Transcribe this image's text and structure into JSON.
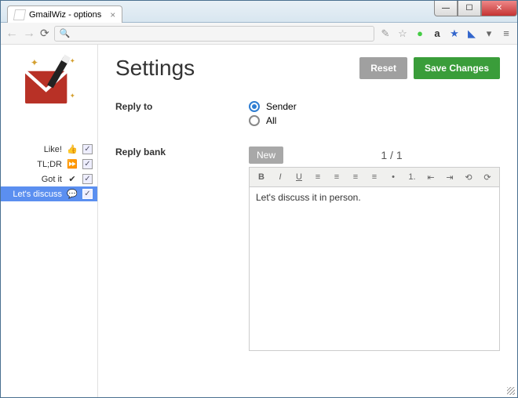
{
  "window": {
    "tab_title": "GmailWiz - options"
  },
  "addressbar": {
    "prefix_icon": "🔍"
  },
  "toolbar_icons": [
    "✎",
    "☆",
    "●",
    "a",
    "★",
    "◣",
    "▾",
    "≡"
  ],
  "sidebar": {
    "items": [
      {
        "label": "Like!",
        "icon": "👍",
        "checked": true,
        "selected": false
      },
      {
        "label": "TL;DR",
        "icon": "⏩",
        "checked": true,
        "selected": false
      },
      {
        "label": "Got it",
        "icon": "✔",
        "checked": true,
        "selected": false
      },
      {
        "label": "Let's discuss",
        "icon": "💬",
        "checked": true,
        "selected": true
      }
    ]
  },
  "page": {
    "title": "Settings",
    "reset_label": "Reset",
    "save_label": "Save Changes"
  },
  "reply_to": {
    "section_label": "Reply to",
    "options": [
      {
        "label": "Sender",
        "checked": true
      },
      {
        "label": "All",
        "checked": false
      }
    ]
  },
  "reply_bank": {
    "section_label": "Reply bank",
    "new_label": "New",
    "pager": "1 / 1",
    "content": "Let's discuss it in person.",
    "editor_buttons": [
      "B",
      "I",
      "U",
      "≡",
      "≡",
      "≡",
      "≡",
      "•",
      "1.",
      "⇤",
      "⇥",
      "⟲",
      "⟳"
    ]
  }
}
